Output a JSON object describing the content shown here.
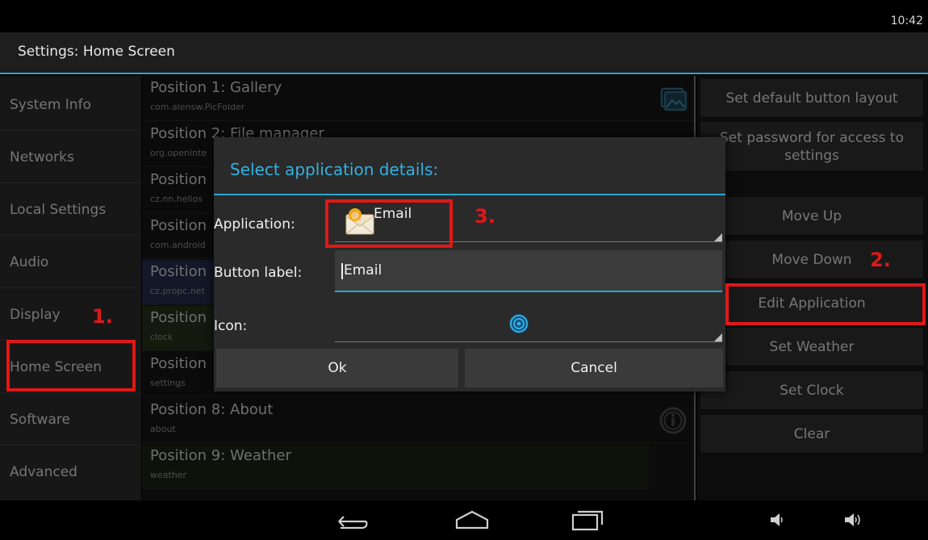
{
  "status_bar": {
    "time": "10:42"
  },
  "action_bar": {
    "title": "Settings: Home Screen"
  },
  "left_menu": {
    "items": [
      {
        "label": "System Info"
      },
      {
        "label": "Networks"
      },
      {
        "label": "Local Settings"
      },
      {
        "label": "Audio"
      },
      {
        "label": "Display"
      },
      {
        "label": "Home Screen"
      },
      {
        "label": "Software"
      },
      {
        "label": "Advanced"
      }
    ]
  },
  "positions": [
    {
      "title": "Position 1: Gallery",
      "package": "com.alensw.PicFolder",
      "icon": "gallery-icon"
    },
    {
      "title": "Position 2: File manager",
      "package": "org.openinte"
    },
    {
      "title": "Position",
      "package": "cz.nn.helios"
    },
    {
      "title": "Position",
      "package": "com.android"
    },
    {
      "title": "Position",
      "package": "cz.propc.net"
    },
    {
      "title": "Position",
      "package": "clock"
    },
    {
      "title": "Position",
      "package": "settings"
    },
    {
      "title": "Position 8: About",
      "package": "about",
      "icon": "info-icon"
    },
    {
      "title": "Position 9: Weather",
      "package": "weather"
    }
  ],
  "right_panel": {
    "buttons": [
      {
        "label": "Set default button layout"
      },
      {
        "label": "Set password for access to settings"
      },
      {
        "label": "Move Up"
      },
      {
        "label": "Move Down"
      },
      {
        "label": "Edit Application"
      },
      {
        "label": "Set Weather"
      },
      {
        "label": "Set Clock"
      },
      {
        "label": "Clear"
      }
    ]
  },
  "dialog": {
    "title": "Select application details:",
    "application_label": "Application:",
    "application_value": "Email",
    "button_label_label": "Button label:",
    "button_label_value": "Email",
    "icon_label": "Icon:",
    "ok": "Ok",
    "cancel": "Cancel"
  },
  "annotations": {
    "step1": "1.",
    "step2": "2.",
    "step3": "3.",
    "color": "#e01818"
  },
  "colors": {
    "accent": "#2aa7d0",
    "annotation": "#e01818"
  },
  "nav_bar": {
    "icons": [
      "back-icon",
      "home-icon",
      "recents-icon",
      "volume-down-icon",
      "volume-up-icon"
    ]
  }
}
